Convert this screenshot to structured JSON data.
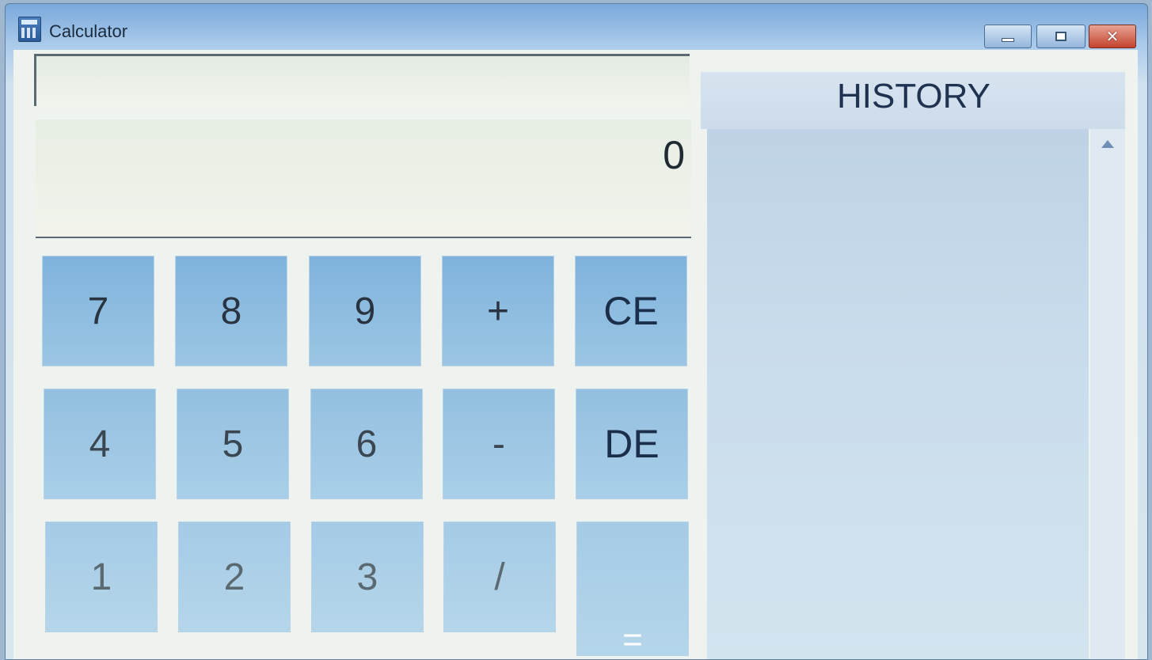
{
  "window": {
    "title": "Calculator",
    "controls": {
      "minimize": "minimize",
      "maximize": "maximize",
      "close": "✕"
    }
  },
  "calculator": {
    "expression": "",
    "display_value": "0",
    "keys": [
      [
        "7",
        "8",
        "9",
        "+",
        "CE"
      ],
      [
        "4",
        "5",
        "6",
        "-",
        "DE"
      ],
      [
        "1",
        "2",
        "3",
        "/",
        "="
      ]
    ]
  },
  "history": {
    "title": "HISTORY",
    "entries": []
  },
  "colors": {
    "accent": "#7fb3dc",
    "title_bar": "#78a8da",
    "close_button": "#c4432d"
  },
  "icons": {
    "app": "calculator-icon",
    "scroll": "triangle-up-icon"
  }
}
